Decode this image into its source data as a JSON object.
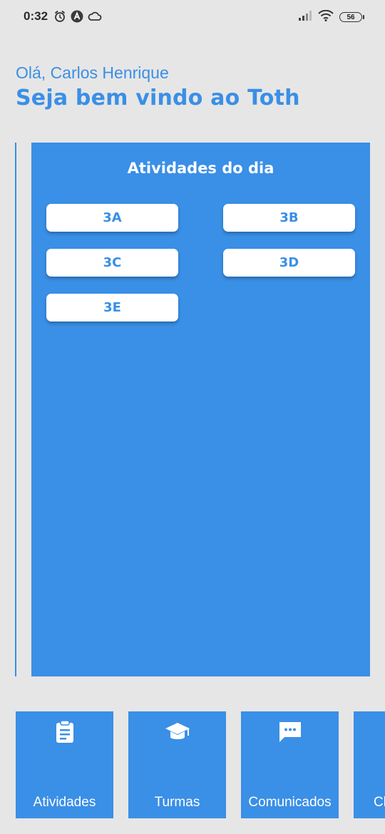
{
  "status_bar": {
    "time": "0:32",
    "battery": "56",
    "icons": [
      "alarm-icon",
      "a-badge-icon",
      "cloud-icon",
      "signal-icon",
      "wifi-icon",
      "battery-icon"
    ]
  },
  "header": {
    "greeting": "Olá, Carlos Henrique",
    "welcome": "Seja bem vindo ao Toth"
  },
  "activities": {
    "title": "Atividades do dia",
    "classes": [
      "3A",
      "3B",
      "3C",
      "3D",
      "3E"
    ]
  },
  "nav": {
    "items": [
      {
        "label": "Atividades",
        "icon": "clipboard-icon"
      },
      {
        "label": "Turmas",
        "icon": "graduation-cap-icon"
      },
      {
        "label": "Comunicados",
        "icon": "chat-icon"
      },
      {
        "label": "Cl",
        "icon": ""
      }
    ]
  },
  "colors": {
    "accent": "#3a8fe6",
    "background": "#e6e6e6",
    "card_text": "#ffffff"
  }
}
